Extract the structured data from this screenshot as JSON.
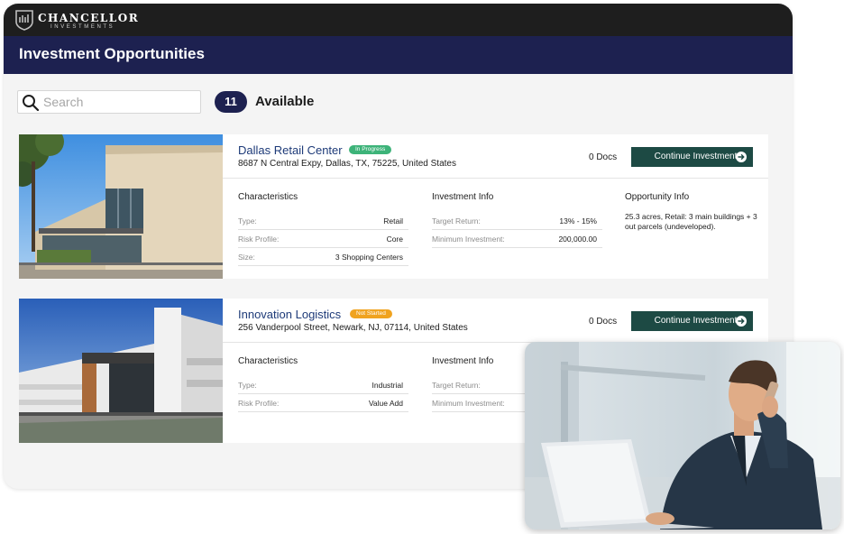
{
  "brand": {
    "name": "CHANCELLOR",
    "tagline": "INVESTMENTS"
  },
  "page": {
    "title": "Investment Opportunities"
  },
  "search": {
    "placeholder": "Search",
    "value": ""
  },
  "summary": {
    "count": "11",
    "label": "Available"
  },
  "opportunities": [
    {
      "name": "Dallas Retail Center",
      "status": "In Progress",
      "status_color": "#3db379",
      "address": "8687 N Central Expy, Dallas, TX, 75225, United States",
      "docs": "0 Docs",
      "action": "Continue Investment",
      "characteristics_title": "Characteristics",
      "characteristics": [
        {
          "label": "Type:",
          "value": "Retail"
        },
        {
          "label": "Risk Profile:",
          "value": "Core"
        },
        {
          "label": "Size:",
          "value": "3 Shopping Centers"
        }
      ],
      "investment_title": "Investment Info",
      "investment": [
        {
          "label": "Target Return:",
          "value": "13% - 15%"
        },
        {
          "label": "Minimum Investment:",
          "value": "200,000.00"
        }
      ],
      "opportunity_title": "Opportunity Info",
      "opportunity_info": "25.3 acres, Retail: 3 main buildings + 3 out parcels (undeveloped)."
    },
    {
      "name": "Innovation Logistics",
      "status": "Not Started",
      "status_color": "#f0a31f",
      "address": "256 Vanderpool Street, Newark, NJ, 07114, United States",
      "docs": "0 Docs",
      "action": "Continue Investment",
      "characteristics_title": "Characteristics",
      "characteristics": [
        {
          "label": "Type:",
          "value": "Industrial"
        },
        {
          "label": "Risk Profile:",
          "value": "Value Add"
        }
      ],
      "investment_title": "Investment Info",
      "investment": [
        {
          "label": "Target Return:",
          "value": ""
        },
        {
          "label": "Minimum Investment:",
          "value": ""
        }
      ]
    }
  ],
  "colors": {
    "navy": "#1d2150",
    "brand_bar": "#1e1e1e",
    "cta": "#1d4a44",
    "title_link": "#1d3a78"
  },
  "icons": [
    "logo-crest-icon",
    "search-icon",
    "arrow-right-circle-icon"
  ]
}
